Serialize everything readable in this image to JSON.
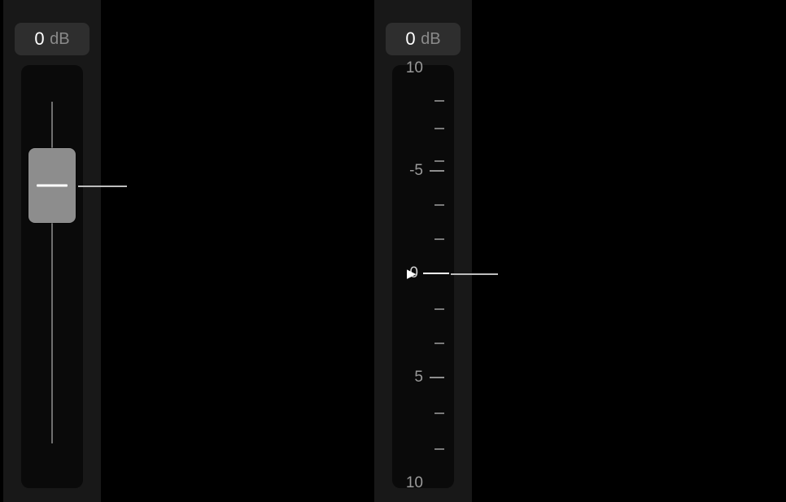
{
  "left": {
    "value": "0",
    "unit": "dB"
  },
  "right": {
    "value": "0",
    "unit": "dB",
    "scale": {
      "top_edge": "10",
      "minus5": "-5",
      "zero": "0",
      "plus5": "5",
      "bottom_edge": "10"
    }
  }
}
